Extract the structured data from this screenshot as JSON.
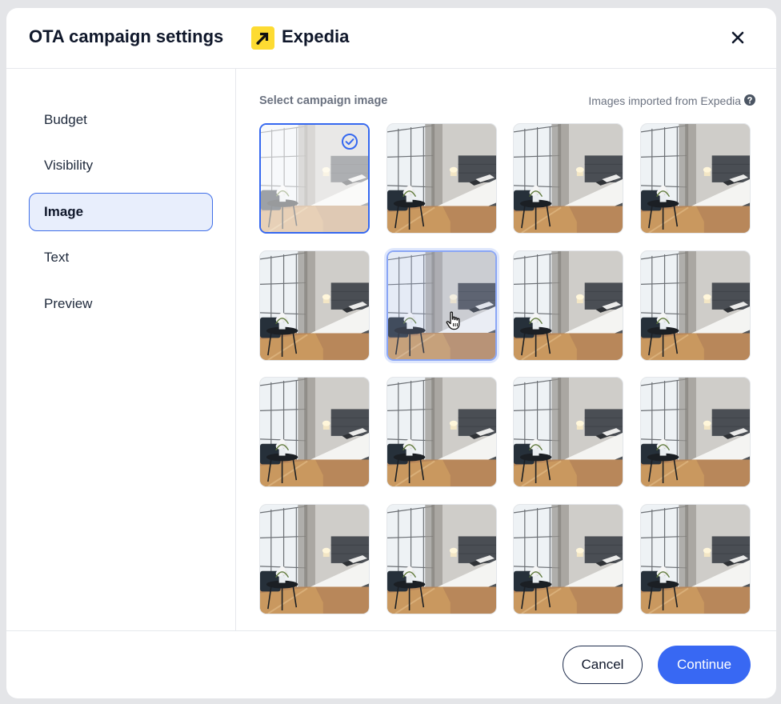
{
  "header": {
    "title": "OTA campaign settings",
    "brand_name": "Expedia",
    "brand_logo_color": "#fddb32",
    "close_icon": "close-icon"
  },
  "sidebar": {
    "items": [
      {
        "label": "Budget",
        "active": false
      },
      {
        "label": "Visibility",
        "active": false
      },
      {
        "label": "Image",
        "active": true
      },
      {
        "label": "Text",
        "active": false
      },
      {
        "label": "Preview",
        "active": false
      }
    ]
  },
  "content": {
    "section_title": "Select campaign image",
    "import_note": "Images imported from Expedia",
    "help_icon": "question-circle-icon",
    "images": {
      "count": 16,
      "selected_index": 0,
      "hovered_index": 5,
      "subject": "hotel-bedroom-photo"
    }
  },
  "footer": {
    "cancel_label": "Cancel",
    "continue_label": "Continue"
  },
  "colors": {
    "accent": "#3868f3",
    "active_nav_bg": "#e8eefc",
    "page_bg": "#e4e5e8"
  }
}
